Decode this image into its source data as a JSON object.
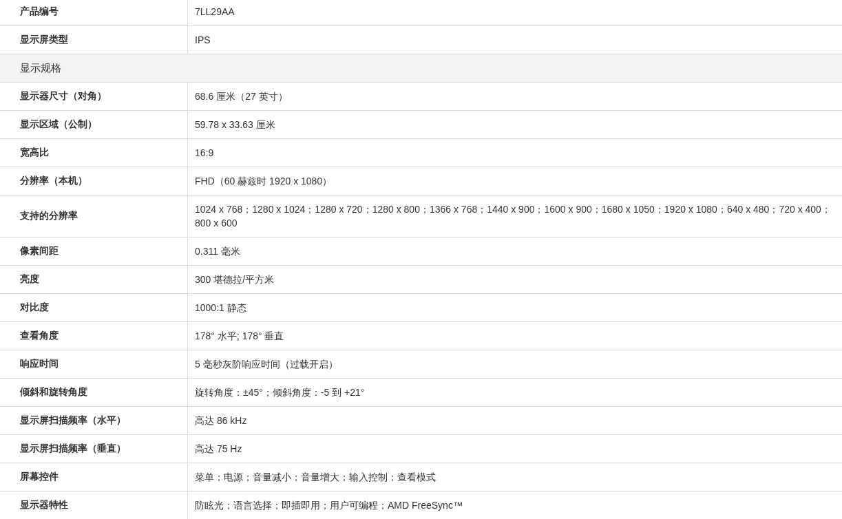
{
  "spec_table": {
    "rows": [
      {
        "kind": "row",
        "label": "产品编号",
        "value": "7LL29AA"
      },
      {
        "kind": "row",
        "label": "显示屏类型",
        "value": "IPS"
      },
      {
        "kind": "section",
        "label": "显示规格"
      },
      {
        "kind": "row",
        "label": "显示器尺寸（对角）",
        "value": "68.6 厘米（27 英寸）"
      },
      {
        "kind": "row",
        "label": "显示区域（公制）",
        "value": "59.78 x 33.63 厘米"
      },
      {
        "kind": "row",
        "label": "宽高比",
        "value": "16:9"
      },
      {
        "kind": "row",
        "label": "分辨率（本机）",
        "value": "FHD（60 赫兹时 1920 x 1080）"
      },
      {
        "kind": "row",
        "label": "支持的分辨率",
        "value": "1024 x 768；1280 x 1024；1280 x 720；1280 x 800；1366 x 768；1440 x 900；1600 x 900；1680 x 1050；1920 x 1080；640 x 480；720 x 400；800 x 600"
      },
      {
        "kind": "row",
        "label": "像素间距",
        "value": "0.311 毫米"
      },
      {
        "kind": "row",
        "label": "亮度",
        "value": "300 堪德拉/平方米"
      },
      {
        "kind": "row",
        "label": "对比度",
        "value": "1000:1 静态"
      },
      {
        "kind": "row",
        "label": "查看角度",
        "value": "178° 水平; 178° 垂直"
      },
      {
        "kind": "row",
        "label": "响应时间",
        "value": "5 毫秒灰阶响应时间（过载开启）"
      },
      {
        "kind": "row",
        "label": "倾斜和旋转角度",
        "value": "旋转角度：±45°；倾斜角度：-5 到 +21°"
      },
      {
        "kind": "row",
        "label": "显示屏扫描频率（水平）",
        "value": "高达 86 kHz"
      },
      {
        "kind": "row",
        "label": "显示屏扫描频率（垂直）",
        "value": "高达 75 Hz"
      },
      {
        "kind": "row",
        "label": "屏幕控件",
        "value": "菜单；电源；音量减小；音量增大；输入控制；查看模式"
      },
      {
        "kind": "row",
        "label": "显示器特性",
        "value": "防眩光；语言选择；即插即用；用户可编程；AMD FreeSync™"
      }
    ]
  }
}
